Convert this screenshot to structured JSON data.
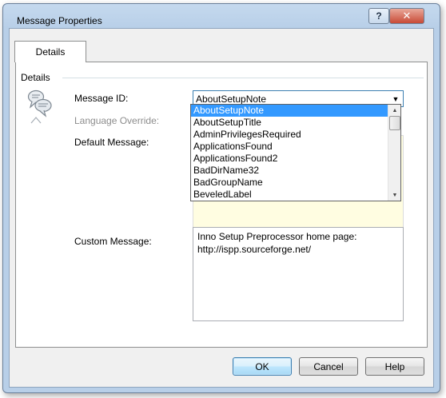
{
  "window": {
    "title": "Message Properties",
    "help_glyph": "?",
    "close_glyph": "✕"
  },
  "tabs": [
    {
      "label": "Details",
      "selected": true
    }
  ],
  "details": {
    "group_title": "Details",
    "message_id_label": "Message ID:",
    "message_id_value": "AboutSetupNote",
    "language_override_label": "Language Override:",
    "default_message_label": "Default Message:",
    "custom_message_label": "Custom Message:",
    "custom_message_lines": [
      "Inno Setup Preprocessor home page:",
      "http://ispp.sourceforge.net/"
    ]
  },
  "dropdown": {
    "items": [
      "AboutSetupNote",
      "AboutSetupTitle",
      "AdminPrivilegesRequired",
      "ApplicationsFound",
      "ApplicationsFound2",
      "BadDirName32",
      "BadGroupName",
      "BeveledLabel"
    ],
    "selected_index": 0
  },
  "buttons": {
    "ok": "OK",
    "cancel": "Cancel",
    "help": "Help"
  },
  "colors": {
    "selection": "#3399ff",
    "default_message_bg": "#fffde1",
    "focus_border": "#3c7fb1"
  }
}
